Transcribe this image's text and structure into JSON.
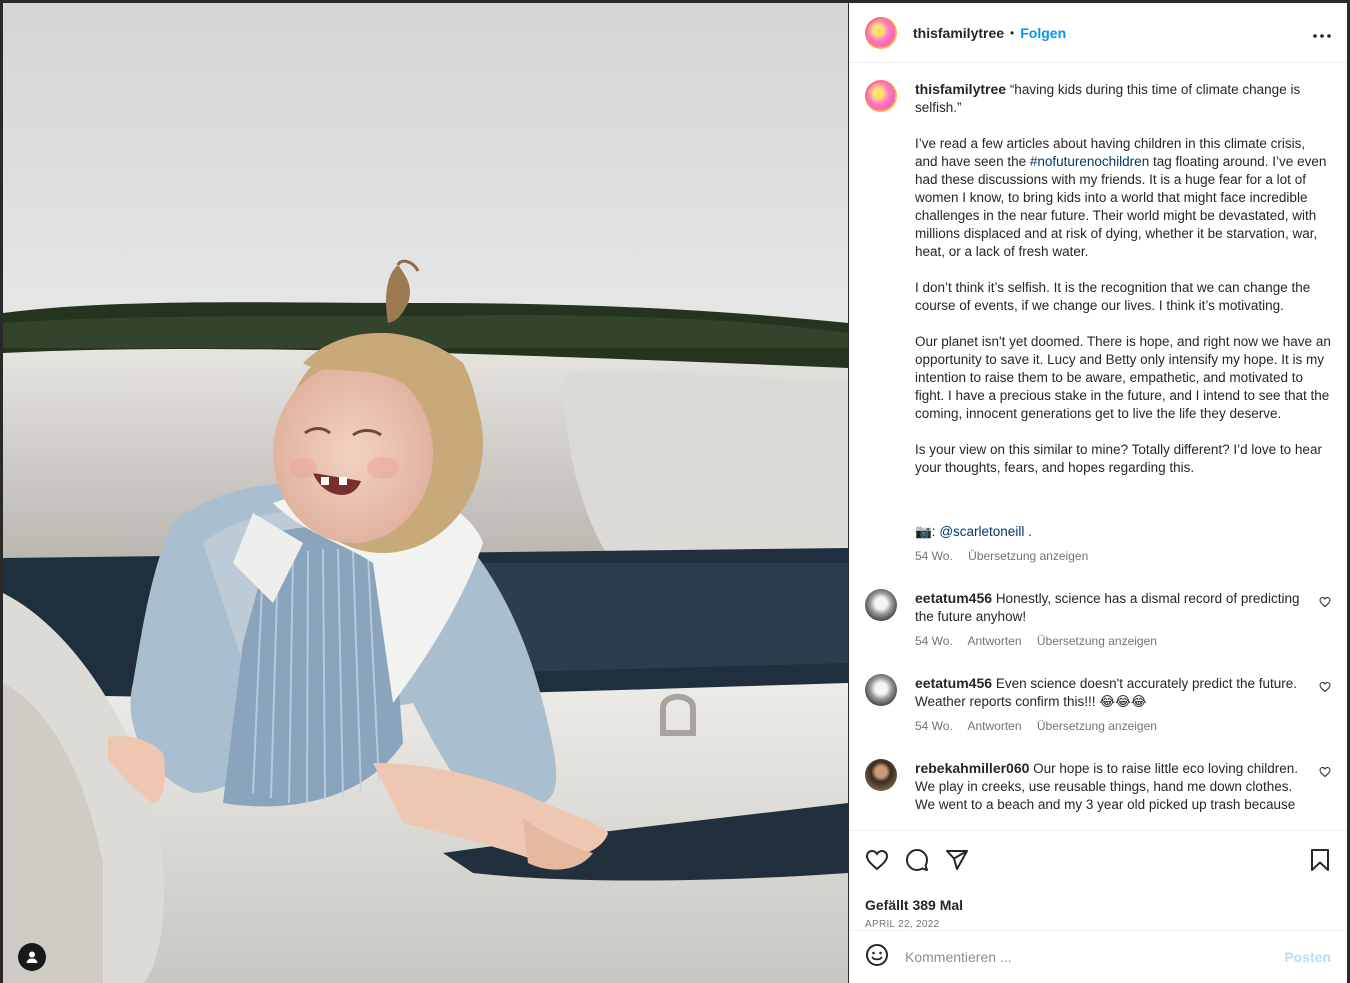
{
  "post": {
    "username": "thisfamilytree",
    "separator": "•",
    "follow_label": "Folgen",
    "more_label": "•••"
  },
  "caption": {
    "username": "thisfamilytree",
    "paragraphs": [
      "“having kids during this time of climate change is selfish.”",
      "I’ve read a few articles about having children in this climate crisis, and have seen the",
      "tag floating around. I’ve even had these discussions with my friends. It is a huge fear for a lot of women I know, to bring kids into a world that might face incredible challenges in the near future. Their world might be devastated, with millions displaced and at risk of dying, whether it be starvation, war, heat, or a lack of fresh water.",
      "I don’t think it’s selfish. It is the recognition that we can change the course of events, if we change our lives. I think it’s motivating.",
      "Our planet isn't yet doomed. There is hope, and right now we have an opportunity to save it. Lucy and Betty only intensify my hope. It is my intention to raise them to be aware, empathetic, and motivated to fight. I have a precious stake in the future, and I intend to see that the coming, innocent generations get to live the life they deserve.",
      "Is your view on this similar to mine? Totally different? I’d love to hear your thoughts, fears, and hopes regarding this."
    ],
    "hashtag": "#nofuturenochildren",
    "camera_emoji": "📷:",
    "mention": "@scarletoneill",
    "mention_suffix": " .",
    "time": "54 Wo.",
    "translate": "Übersetzung anzeigen"
  },
  "comments": [
    {
      "username": "eetatum456",
      "text": "Honestly, science has a dismal record of predicting the future anyhow!",
      "time": "54 Wo.",
      "reply": "Antworten",
      "translate": "Übersetzung anzeigen"
    },
    {
      "username": "eetatum456",
      "text": "Even science doesn't accurately predict the future. Weather reports confirm this!!! 😂😂😂",
      "time": "54 Wo.",
      "reply": "Antworten",
      "translate": "Übersetzung anzeigen"
    },
    {
      "username": "rebekahmiller060",
      "text": "Our hope is to raise little eco loving children. We play in creeks, use reusable things, hand me down clothes. We went to a beach and my 3 year old picked up trash because"
    }
  ],
  "likes": "Gefällt 389 Mal",
  "date": "APRIL 22, 2022",
  "comment_input": {
    "placeholder": "Kommentieren ...",
    "post_label": "Posten"
  },
  "colors": {
    "link_blue": "#0095f6",
    "mention_blue": "#00376b",
    "muted": "#737373",
    "post_disabled": "#b2dffc"
  },
  "icons": [
    "heart-icon",
    "comment-icon",
    "share-icon",
    "bookmark-icon",
    "emoji-icon",
    "user-icon",
    "more-icon"
  ]
}
